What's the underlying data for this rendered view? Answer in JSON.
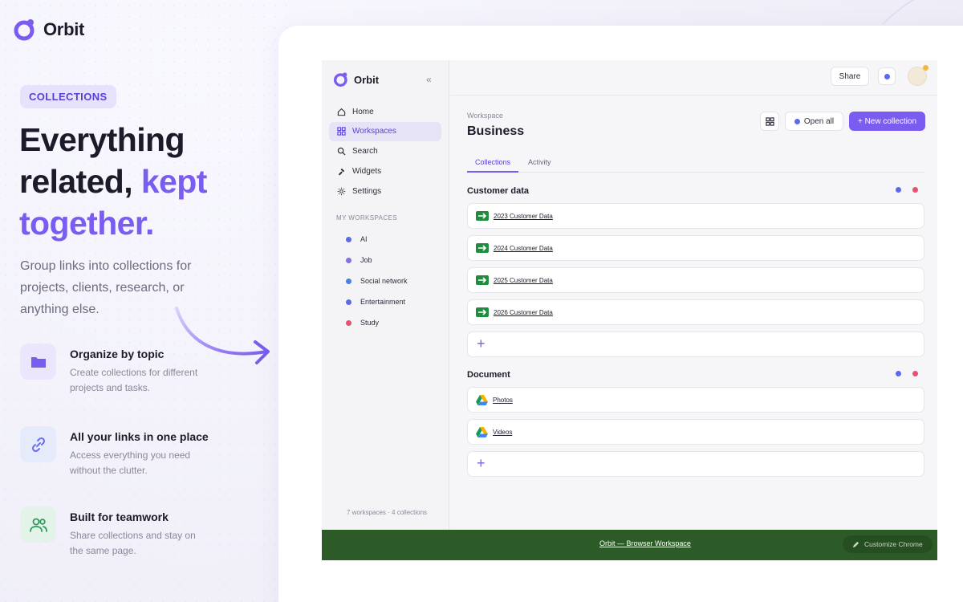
{
  "brand": {
    "name": "Orbit"
  },
  "hero": {
    "badge": "COLLECTIONS",
    "headline_line1": "Everything",
    "headline_line2a": "related,",
    "headline_line2b": "kept",
    "headline_line3": "together.",
    "subcopy": "Group links into collections for projects, clients, research, or anything else."
  },
  "features": [
    {
      "icon": "folder-icon",
      "title": "Organize by topic",
      "desc": "Create collections for different projects and tasks."
    },
    {
      "icon": "link-icon",
      "title": "All your links in one place",
      "desc": "Access everything you need without the clutter."
    },
    {
      "icon": "users-icon",
      "title": "Built for teamwork",
      "desc": "Share collections and stay on the same page."
    }
  ],
  "app": {
    "brand": "Orbit",
    "collapse": "«",
    "nav": [
      {
        "icon": "home-icon",
        "label": "Home"
      },
      {
        "icon": "grid-icon",
        "label": "Workspaces",
        "active": true
      },
      {
        "icon": "search-icon",
        "label": "Search"
      },
      {
        "icon": "widgets-icon",
        "label": "Widgets"
      },
      {
        "icon": "gear-icon",
        "label": "Settings"
      }
    ],
    "workspaces_heading": "MY WORKSPACES",
    "workspaces": [
      {
        "label": "AI",
        "color": "#5b6be8"
      },
      {
        "label": "Job",
        "color": "#8a6ee6"
      },
      {
        "label": "Social network",
        "color": "#4a7fe0"
      },
      {
        "label": "Entertainment",
        "color": "#5b6be8"
      },
      {
        "label": "Study",
        "color": "#e8506e"
      }
    ],
    "footer": "7 workspaces · 4 collections",
    "topbar": {
      "share": "Share"
    },
    "breadcrumb": "Workspace",
    "title": "Business",
    "actions": {
      "open_all": "Open all",
      "new_collection": "+ New collection"
    },
    "tabs": [
      "Collections",
      "Activity"
    ],
    "sections": [
      {
        "title": "Customer data",
        "links": [
          "2023 Customer Data",
          "2024 Customer Data",
          "2025 Customer Data",
          "2026 Customer Data"
        ],
        "link_icon": "sheets-icon"
      },
      {
        "title": "Document",
        "links": [
          "Photos",
          "Videos"
        ],
        "link_icon": "drive-icon"
      }
    ],
    "add": "+",
    "bottom_bar": {
      "link": "Orbit — Browser Workspace",
      "customize": "Customize Chrome",
      "color": "#2d5b27"
    }
  },
  "colors": {
    "accent": "#7b5cf0",
    "text": "#1c1b29"
  }
}
